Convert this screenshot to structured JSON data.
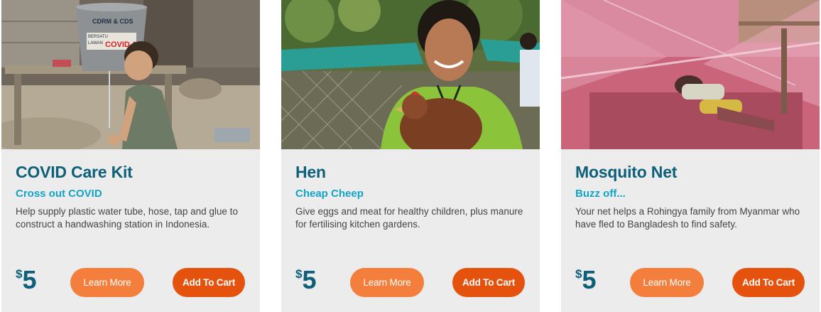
{
  "cards": [
    {
      "title": "COVID Care Kit",
      "subtitle": "Cross out COVID",
      "description": "Help supply plastic water tube, hose, tap and glue to construct a handwashing station in Indonesia.",
      "currency": "$",
      "price": "5",
      "learn_label": "Learn More",
      "cart_label": "Add To Cart",
      "photo_text": [
        "CDRM & CDS",
        "BERSATU",
        "LAWAN",
        "COVID-19"
      ]
    },
    {
      "title": "Hen",
      "subtitle": "Cheap Cheep",
      "description": "Give eggs and meat for healthy children, plus manure for fertilising kitchen gardens.",
      "currency": "$",
      "price": "5",
      "learn_label": "Learn More",
      "cart_label": "Add To Cart"
    },
    {
      "title": "Mosquito Net",
      "subtitle": "Buzz off...",
      "description": "Your net helps a Rohingya family from Myanmar who have fled to Bangladesh to find safety.",
      "currency": "$",
      "price": "5",
      "learn_label": "Learn More",
      "cart_label": "Add To Cart"
    }
  ],
  "colors": {
    "title": "#0d5f7a",
    "subtitle": "#12a4c9",
    "learn_button": "#f47f3c",
    "cart_button": "#e5520d",
    "card_background": "#ececec"
  }
}
